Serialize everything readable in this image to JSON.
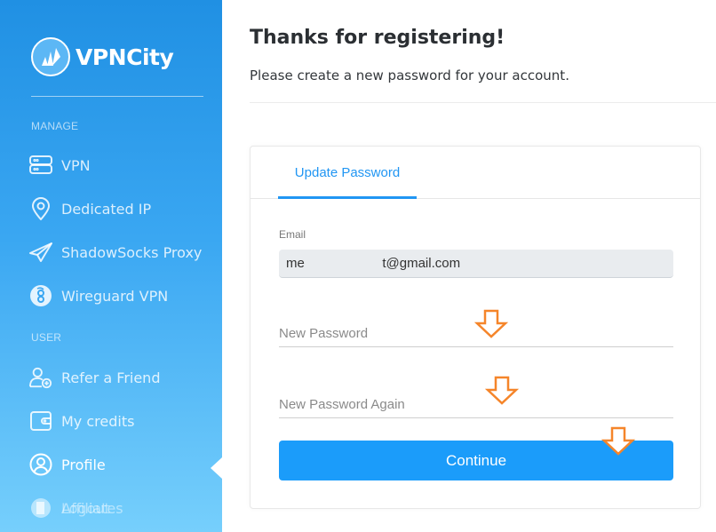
{
  "brand": {
    "name": "VPNCity",
    "accent": "#2196f3",
    "button_color": "#1b9cfa",
    "annotation_color": "#f5852a"
  },
  "sidebar": {
    "sections": [
      {
        "label": "MANAGE",
        "items": [
          {
            "label": "VPN",
            "icon": "server-icon"
          },
          {
            "label": "Dedicated IP",
            "icon": "location-pin-icon"
          },
          {
            "label": "ShadowSocks Proxy",
            "icon": "paper-plane-icon"
          },
          {
            "label": "Wireguard VPN",
            "icon": "wireguard-icon"
          }
        ]
      },
      {
        "label": "USER",
        "items": [
          {
            "label": "Refer a Friend",
            "icon": "add-user-icon"
          },
          {
            "label": "My credits",
            "icon": "wallet-icon"
          },
          {
            "label": "Profile",
            "icon": "user-circle-icon",
            "active": true
          },
          {
            "label": "Affiliates",
            "icon": "affiliates-icon"
          },
          {
            "label": "Logout",
            "icon": "logout-icon"
          }
        ]
      }
    ]
  },
  "main": {
    "title": "Thanks for registering!",
    "subtitle": "Please create a new password for your account.",
    "card": {
      "tabs": [
        {
          "label": "Update Password",
          "active": true
        }
      ],
      "email_label": "Email",
      "email_value": "me                     t@gmail.com",
      "new_password_placeholder": "New Password",
      "new_password_value": "",
      "new_password_again_placeholder": "New Password Again",
      "new_password_again_value": "",
      "continue_label": "Continue"
    }
  }
}
